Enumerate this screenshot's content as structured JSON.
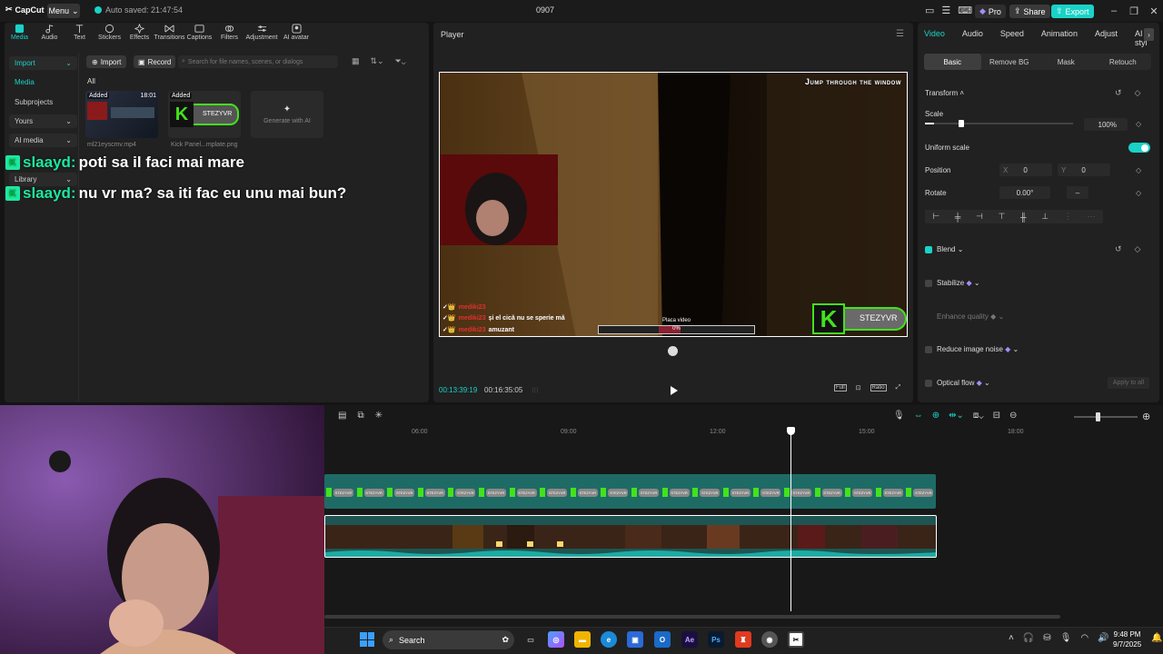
{
  "app": {
    "name": "CapCut",
    "menu_label": "Menu",
    "autosave": "Auto saved: 21:47:54",
    "project_title": "0907",
    "pro_label": "Pro",
    "share_label": "Share",
    "export_label": "Export",
    "accent": "#1ad2c7"
  },
  "toolbar": {
    "items": [
      {
        "label": "Media",
        "icon": "media-icon"
      },
      {
        "label": "Audio",
        "icon": "audio-icon"
      },
      {
        "label": "Text",
        "icon": "text-icon"
      },
      {
        "label": "Stickers",
        "icon": "stickers-icon"
      },
      {
        "label": "Effects",
        "icon": "effects-icon"
      },
      {
        "label": "Transitions",
        "icon": "transitions-icon"
      },
      {
        "label": "Captions",
        "icon": "captions-icon"
      },
      {
        "label": "Filters",
        "icon": "filters-icon"
      },
      {
        "label": "Adjustment",
        "icon": "adjustment-icon"
      },
      {
        "label": "AI avatar",
        "icon": "ai-avatar-icon"
      }
    ]
  },
  "side_nav": {
    "import": "Import",
    "media": "Media",
    "subprojects": "Subprojects",
    "yours": "Yours",
    "ai_media": "AI media",
    "library": "Library"
  },
  "media_panel": {
    "import_btn": "Import",
    "record_btn": "Record",
    "search_placeholder": "Search for file names, scenes, or dialogs",
    "all_label": "All",
    "items": [
      {
        "badge": "Added",
        "duration": "18:01",
        "name": "ml21eyscmv.mp4"
      },
      {
        "badge": "Added",
        "name": "Kick Panel...mplate.png",
        "thumb_text": "STEZYVR"
      }
    ],
    "generate_ai": "Generate with AI"
  },
  "chat_overlay": [
    {
      "user": "slaayd:",
      "message": "poti sa il faci mai mare"
    },
    {
      "user": "slaayd:",
      "message": "nu vr ma? sa iti fac eu unu mai bun?"
    }
  ],
  "player": {
    "title": "Player",
    "video_caption": "Jump through the window",
    "chat": [
      {
        "user": "mediki23",
        "message": ""
      },
      {
        "user": "mediki23",
        "message": "și el cică nu se sperie mă"
      },
      {
        "user": "mediki23",
        "message": "amuzant"
      }
    ],
    "progress_label": "Placa video",
    "progress_value": "0%",
    "kick_name": "STEZYVR",
    "time_current": "00:13:39:19",
    "time_total": "00:16:35:05",
    "tool_labels": [
      "Full",
      "Ratio"
    ]
  },
  "right_panel": {
    "tabs": [
      "Video",
      "Audio",
      "Speed",
      "Animation",
      "Adjust",
      "AI styl"
    ],
    "subtabs": [
      "Basic",
      "Remove BG",
      "Mask",
      "Retouch"
    ],
    "transform": "Transform",
    "scale_label": "Scale",
    "scale_value": "100%",
    "scale_level": 0.06,
    "uniform_scale": "Uniform scale",
    "position_label": "Position",
    "pos_x_label": "X",
    "pos_x": "0",
    "pos_y_label": "Y",
    "pos_y": "0",
    "rotate_label": "Rotate",
    "rotate_value": "0.00°",
    "rotate_extra": "–",
    "blend": "Blend",
    "stabilize": "Stabilize",
    "enhance": "Enhance quality",
    "reduce_noise": "Reduce image noise",
    "optical_flow": "Optical flow",
    "apply_all": "Apply to all"
  },
  "timeline": {
    "ruler": [
      "06:00",
      "09:00",
      "12:00",
      "15:00",
      "18:00"
    ],
    "clip_label": "STEZYVR"
  },
  "taskbar": {
    "search": "Search",
    "time": "9:48 PM",
    "date": "9/7/2025",
    "apps": [
      "Ae",
      "Ps"
    ]
  }
}
